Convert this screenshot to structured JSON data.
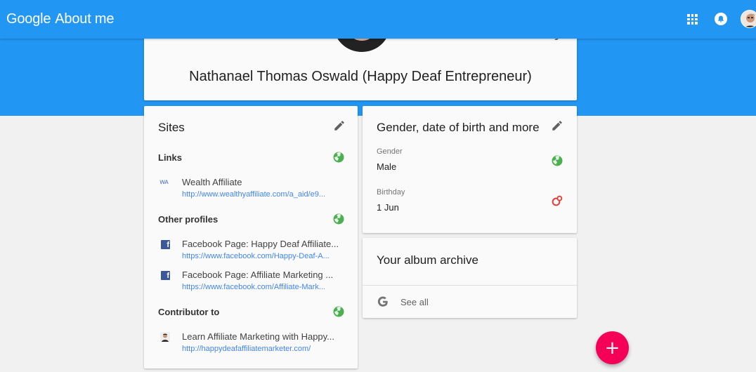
{
  "app": {
    "brand_google": "Google",
    "brand_product": "About me"
  },
  "topbar": {
    "apps_icon": "apps-grid-icon",
    "notifications_icon": "bell-icon",
    "account_icon": "account-avatar"
  },
  "profile": {
    "name": "Nathanael Thomas Oswald (Happy Deaf Entrepreneur)"
  },
  "sites": {
    "title": "Sites",
    "links": {
      "title": "Links",
      "items": [
        {
          "title": "Wealth Affiliate",
          "url": "http://www.wealthyaffiliate.com/a_aid/e9...",
          "icon": "wa-logo",
          "icon_text": "ᴡᴀ"
        }
      ]
    },
    "other_profiles": {
      "title": "Other profiles",
      "items": [
        {
          "title": "Facebook Page: Happy Deaf Affiliate...",
          "url": "https://www.facebook.com/Happy-Deaf-A...",
          "icon": "facebook-icon"
        },
        {
          "title": "Facebook Page: Affiliate Marketing ...",
          "url": "https://www.facebook.com/Affiliate-Mark...",
          "icon": "facebook-icon"
        }
      ]
    },
    "contributor": {
      "title": "Contributor to",
      "items": [
        {
          "title": "Learn Affiliate Marketing with Happy...",
          "url": "http://happydeafaffiliatemarketer.com/",
          "icon": "site-avatar"
        }
      ]
    }
  },
  "details": {
    "title": "Gender, date of birth and more",
    "gender_label": "Gender",
    "gender_value": "Male",
    "birthday_label": "Birthday",
    "birthday_value": "1 Jun"
  },
  "album": {
    "title": "Your album archive",
    "see_all": "See all"
  },
  "fab": {
    "label": "+"
  },
  "colors": {
    "primary": "#2196f3",
    "accent": "#f50057",
    "public": "#4caf50",
    "restricted": "#e53935",
    "link": "#4285f4",
    "facebook": "#3b5998"
  }
}
